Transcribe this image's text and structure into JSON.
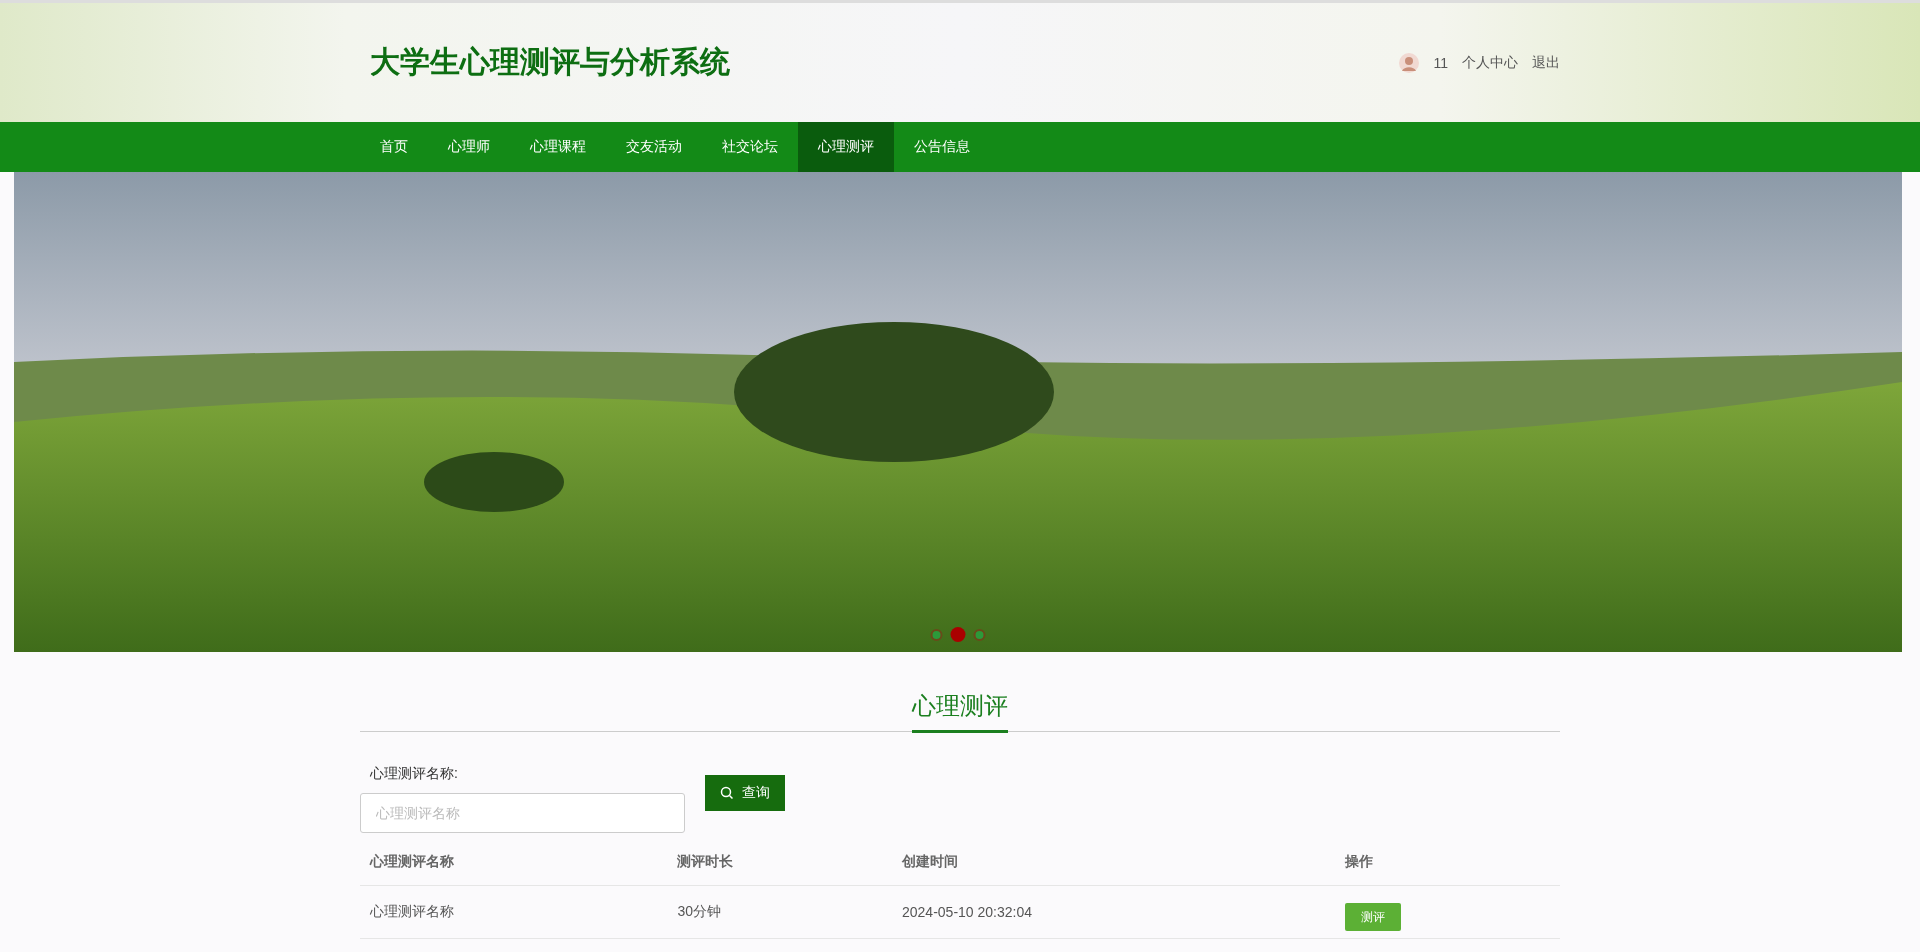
{
  "header": {
    "title": "大学生心理测评与分析系统",
    "user": {
      "name": "11",
      "links": [
        "个人中心",
        "退出"
      ]
    }
  },
  "nav": [
    {
      "label": "首页",
      "selected": false
    },
    {
      "label": "心理师",
      "selected": false
    },
    {
      "label": "心理课程",
      "selected": false
    },
    {
      "label": "交友活动",
      "selected": false
    },
    {
      "label": "社交论坛",
      "selected": false
    },
    {
      "label": "心理测评",
      "selected": true
    },
    {
      "label": "公告信息",
      "selected": false
    }
  ],
  "carousel": {
    "dots": [
      {
        "selected": false
      },
      {
        "selected": true
      },
      {
        "selected": false
      }
    ]
  },
  "section": {
    "title": "心理测评"
  },
  "search": {
    "label": "心理测评名称:",
    "placeholder": "心理测评名称",
    "button": "查询"
  },
  "table": {
    "columns": [
      "心理测评名称",
      "测评时长",
      "创建时间",
      "操作"
    ],
    "rows": [
      {
        "cells": [
          "心理测评名称",
          "30分钟",
          "2024-05-10 20:32:04"
        ],
        "action": "测评"
      }
    ]
  }
}
